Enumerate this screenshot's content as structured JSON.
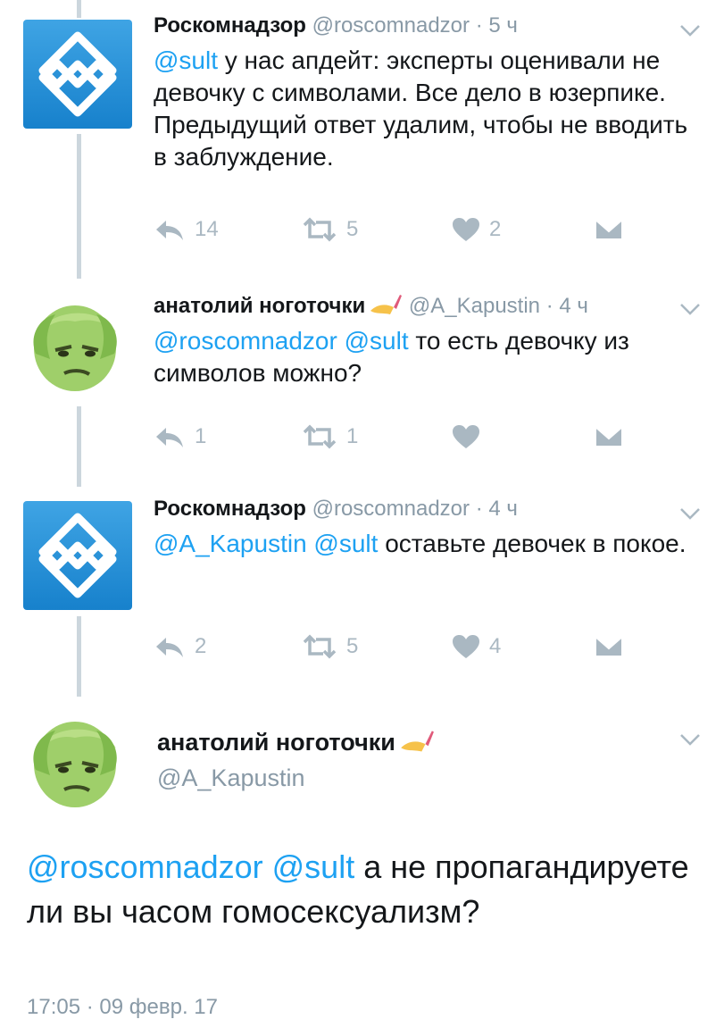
{
  "colors": {
    "accent": "#1da1f2",
    "muted": "#8899a6",
    "icon": "#aab8c2",
    "line": "#ccd6dd",
    "avatar_blue": "#1d8fd8"
  },
  "tweets": [
    {
      "name": "Роскомнадзор",
      "handle": "@roscomnadzor",
      "dot": "·",
      "time": "5 ч",
      "text_mention": "@sult",
      "text": " у нас апдейт: эксперты оценивали не девочку с символами. Все дело в юзерпике. Предыдущий ответ удалим, чтобы не вводить в заблуждение.",
      "reply_count": "14",
      "retweet_count": "5",
      "like_count": "2",
      "icons": {
        "reply": "reply-icon",
        "retweet": "retweet-icon",
        "like": "heart-icon",
        "dm": "direct-message-icon",
        "menu": "chevron-down-icon"
      }
    },
    {
      "name": "анатолий ноготочки",
      "handle": "@A_Kapustin",
      "dot": "·",
      "time": "4 ч",
      "text_mention": "@roscomnadzor @sult",
      "text": " то есть девочку из символов можно?",
      "reply_count": "1",
      "retweet_count": "1",
      "like_count": "",
      "icons": {
        "emoji": "nail-polish-emoji"
      }
    },
    {
      "name": "Роскомнадзор",
      "handle": "@roscomnadzor",
      "dot": "·",
      "time": "4 ч",
      "text_mention": "@A_Kapustin @sult",
      "text": " оставьте девочек в покое.",
      "reply_count": "2",
      "retweet_count": "5",
      "like_count": "4"
    }
  ],
  "main_tweet": {
    "name": "анатолий ноготочки",
    "handle": "@A_Kapustin",
    "text_mention": "@roscomnadzor @sult",
    "text": "  а не пропагандируете ли вы часом гомосексуализм?",
    "timestamp": "17:05 · 09 февр. 17"
  }
}
